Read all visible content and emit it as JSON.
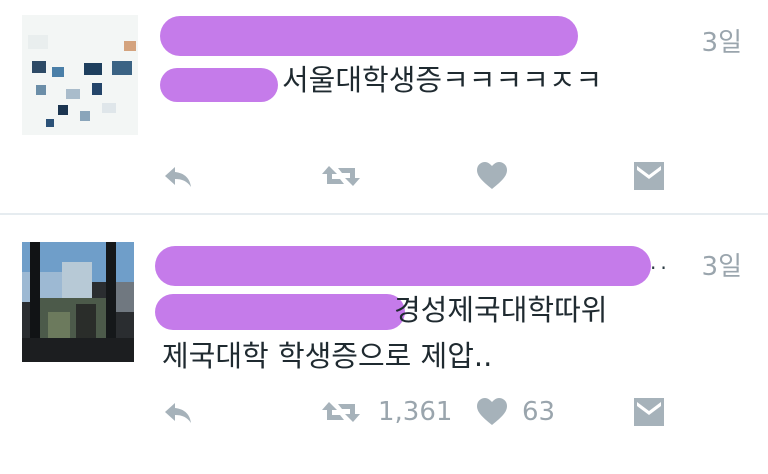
{
  "tweets": [
    {
      "time": "3일",
      "text": "서울대학생증ㅋㅋㅋㅋㅈㅋ",
      "retweets": "",
      "likes": ""
    },
    {
      "time": "3일",
      "text_line1": "경성제국대학따위",
      "text_line2": "제국대학 학생증으로 제압..",
      "retweets": "1,361",
      "likes": "63"
    }
  ],
  "colors": {
    "redaction": "#c57bea",
    "icon": "#a6b2ba",
    "text": "#1f2a30",
    "meta": "#9aa5ad"
  },
  "icons": [
    "reply-icon",
    "retweet-icon",
    "like-icon",
    "dm-icon"
  ]
}
